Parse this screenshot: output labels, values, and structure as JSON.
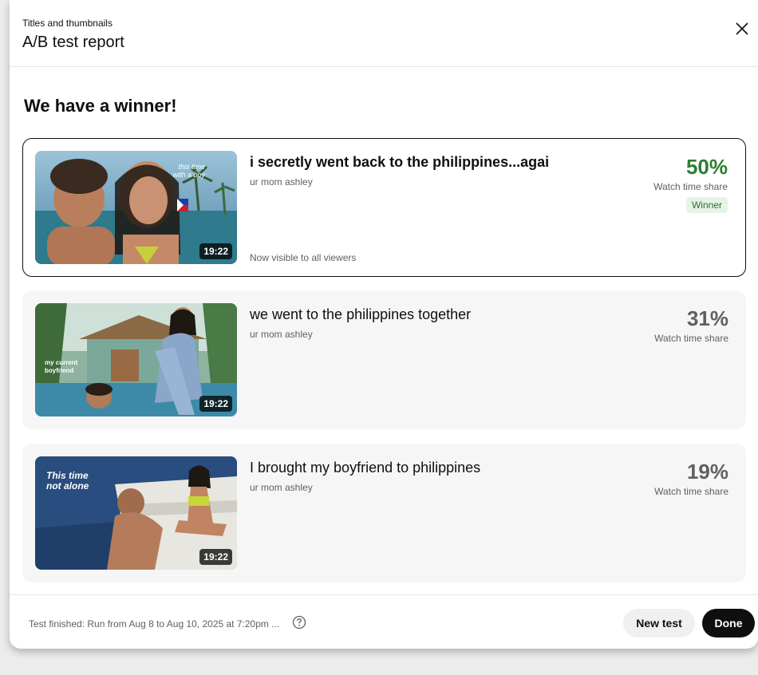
{
  "header": {
    "subtitle": "Titles and thumbnails",
    "title": "A/B test report"
  },
  "heading": "We have a winner!",
  "variants": [
    {
      "title": "i secretly went back to the philippines...agai",
      "channel": "ur mom ashley",
      "duration": "19:22",
      "percent": "50%",
      "share_label": "Watch time share",
      "badge": "Winner",
      "visibility": "Now visible to all viewers",
      "thumb_text": [
        "this time",
        "with a boy"
      ]
    },
    {
      "title": "we went to the philippines together",
      "channel": "ur mom ashley",
      "duration": "19:22",
      "percent": "31%",
      "share_label": "Watch time share",
      "thumb_text": [
        "my current",
        "boyfriend"
      ]
    },
    {
      "title": "I brought my boyfriend to philippines",
      "channel": "ur mom ashley",
      "duration": "19:22",
      "percent": "19%",
      "share_label": "Watch time share",
      "thumb_text": [
        "This time",
        "not alone"
      ]
    }
  ],
  "footer": {
    "status": "Test finished: Run from Aug 8 to Aug 10, 2025 at 7:20pm ...",
    "new_test_label": "New test",
    "done_label": "Done"
  },
  "colors": {
    "winner_green": "#2e7d32",
    "badge_bg": "#e6f4e6",
    "primary_button": "#0f0f0f"
  },
  "icons": {
    "close": "close-icon",
    "help": "help-circle-icon"
  }
}
